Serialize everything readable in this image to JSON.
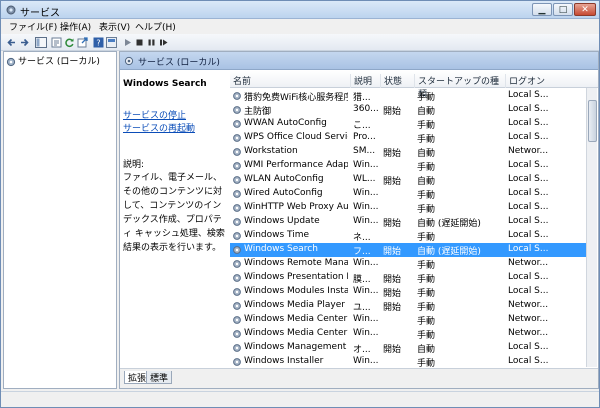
{
  "window": {
    "title": "サービス",
    "min_label": "▁",
    "max_label": "□",
    "close_label": "✕"
  },
  "menu": [
    "ファイル(F)",
    "操作(A)",
    "表示(V)",
    "ヘルプ(H)"
  ],
  "tree": {
    "root_label": "サービス (ローカル)"
  },
  "pane_header": "サービス (ローカル)",
  "details": {
    "service_name": "Windows Search",
    "stop_link": "サービスの停止",
    "restart_link": "サービスの再起動",
    "description_label": "説明:",
    "description": "ファイル、電子メール、その他のコンテンツに対して、コンテンツのインデックス作成、プロパティ キャッシュ処理、検索結果の表示を行います。"
  },
  "columns": [
    "名前",
    "説明",
    "状態",
    "スタートアップの種類",
    "ログオン"
  ],
  "rows": [
    {
      "name": "猎豹免费WiFi核心服务程序",
      "desc": "猎...",
      "state": "",
      "startup": "手動",
      "logon": "Local S..."
    },
    {
      "name": "主防御",
      "desc": "360...",
      "state": "開始",
      "startup": "自動",
      "logon": "Local S..."
    },
    {
      "name": "WWAN AutoConfig",
      "desc": "こ...",
      "state": "",
      "startup": "手動",
      "logon": "Local S..."
    },
    {
      "name": "WPS Office Cloud Service",
      "desc": "Pro...",
      "state": "",
      "startup": "手動",
      "logon": "Local S..."
    },
    {
      "name": "Workstation",
      "desc": "SM...",
      "state": "開始",
      "startup": "自動",
      "logon": "Networ..."
    },
    {
      "name": "WMI Performance Adapter",
      "desc": "Win...",
      "state": "",
      "startup": "手動",
      "logon": "Local S..."
    },
    {
      "name": "WLAN AutoConfig",
      "desc": "WL...",
      "state": "開始",
      "startup": "自動",
      "logon": "Local S..."
    },
    {
      "name": "Wired AutoConfig",
      "desc": "Win...",
      "state": "",
      "startup": "手動",
      "logon": "Local S..."
    },
    {
      "name": "WinHTTP Web Proxy Auto...",
      "desc": "Win...",
      "state": "",
      "startup": "手動",
      "logon": "Local S..."
    },
    {
      "name": "Windows Update",
      "desc": "Win...",
      "state": "開始",
      "startup": "自動 (遅延開始)",
      "logon": "Local S..."
    },
    {
      "name": "Windows Time",
      "desc": "ネ...",
      "state": "",
      "startup": "手動",
      "logon": "Local S..."
    },
    {
      "name": "Windows Search",
      "desc": "フ...",
      "state": "開始",
      "startup": "自動 (遅延開始)",
      "logon": "Local S..."
    },
    {
      "name": "Windows Remote Manage...",
      "desc": "Win...",
      "state": "",
      "startup": "手動",
      "logon": "Networ..."
    },
    {
      "name": "Windows Presentation Fo...",
      "desc": "膜...",
      "state": "開始",
      "startup": "手動",
      "logon": "Local S..."
    },
    {
      "name": "Windows Modules Installer",
      "desc": "Win...",
      "state": "開始",
      "startup": "手動",
      "logon": "Local S..."
    },
    {
      "name": "Windows Media Player Ne...",
      "desc": "ユ...",
      "state": "開始",
      "startup": "手動",
      "logon": "Networ..."
    },
    {
      "name": "Windows Media Center S...",
      "desc": "Win...",
      "state": "",
      "startup": "手動",
      "logon": "Networ..."
    },
    {
      "name": "Windows Media Center R...",
      "desc": "Win...",
      "state": "",
      "startup": "手動",
      "logon": "Networ..."
    },
    {
      "name": "Windows Management In...",
      "desc": "オ...",
      "state": "開始",
      "startup": "自動",
      "logon": "Local S..."
    },
    {
      "name": "Windows Installer",
      "desc": "Win...",
      "state": "",
      "startup": "手動",
      "logon": "Local S..."
    }
  ],
  "selected_row": 11,
  "tabs": [
    "拡張",
    "標準"
  ],
  "colors": {
    "selection": "#3399ff",
    "link": "#0b4db8",
    "pane_header": "#b7cce9"
  }
}
